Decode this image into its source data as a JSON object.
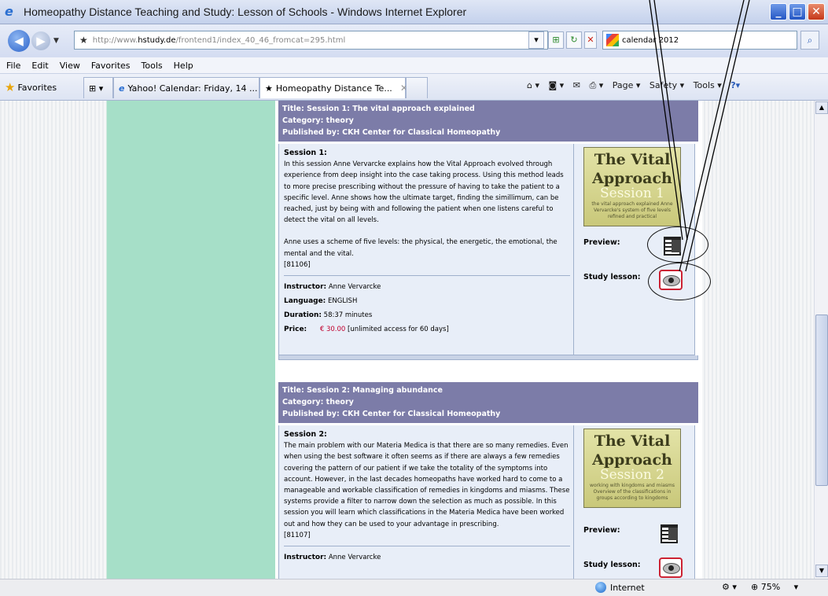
{
  "window": {
    "title": "Homeopathy Distance Teaching and Study: Lesson of Schools - Windows Internet Explorer",
    "minimize": "_",
    "maximize": "□",
    "close": "✕"
  },
  "address": {
    "url_prefix": "http://www.",
    "url_host": "hstudy.de",
    "url_path": "/frontend1/index_40_46_fromcat=295.html",
    "search_value": "calendar 2012"
  },
  "menu": [
    "File",
    "Edit",
    "View",
    "Favorites",
    "Tools",
    "Help"
  ],
  "favorites_label": "Favorites",
  "tabs": [
    {
      "label": "Yahoo! Calendar: Friday, 14 ..."
    },
    {
      "label": "Homeopathy Distance Te...",
      "close": "✕"
    }
  ],
  "command_bar": {
    "page": "Page ▾",
    "safety": "Safety ▾",
    "tools": "Tools ▾"
  },
  "lessons": [
    {
      "title": "Title: Session 1: The vital approach explained",
      "category": "Category: theory",
      "publisher": "Published by: CKH Center for Classical Homeopathy",
      "session": "Session 1:",
      "description": "In this session Anne Vervarcke explains how the Vital Approach evolved through experience from deep insight into the case taking process. Using this method leads to more precise prescribing without the pressure of having to take the patient to a specific level. Anne shows how the ultimate target, finding the simillimum, can be reached, just by being with and following the patient when one listens careful to detect the vital on all levels.",
      "description2": "Anne uses a scheme of five levels: the physical, the energetic, the emotional, the mental and the vital.",
      "code": "[81106]",
      "instructor_label": "Instructor:",
      "instructor": "Anne Vervarcke",
      "language_label": "Language:",
      "language": "ENGLISH",
      "duration_label": "Duration:",
      "duration": "58:37 minutes",
      "price_label": "Price:",
      "price": "€ 30.00",
      "price_note": "[unlimited access for 60 days]",
      "cover_title1": "The Vital",
      "cover_title2": "Approach",
      "cover_session": "Session 1",
      "cover_sub": "the vital approach explained Anne Vervarcke's system of five levels refined and practical",
      "preview_label": "Preview:",
      "study_label": "Study lesson:"
    },
    {
      "title": "Title: Session 2: Managing abundance",
      "category": "Category: theory",
      "publisher": "Published by: CKH Center for Classical Homeopathy",
      "session": "Session 2:",
      "description": "The main problem with our Materia Medica is that there are so many remedies. Even when using the best software it often seems as if there are always a few remedies covering the pattern of our patient if we take the totality of the symptoms into account. However, in the last decades homeopaths have worked hard to come to a manageable and workable classification of remedies in kingdoms and miasms. These systems provide a filter to narrow down the selection as much as possible. In this session you will learn which classifications in the Materia Medica have been worked out and how they can be used to your advantage in prescribing.",
      "code": "[81107]",
      "instructor_label": "Instructor:",
      "instructor": "Anne Vervarcke",
      "cover_title1": "The Vital",
      "cover_title2": "Approach",
      "cover_session": "Session 2",
      "cover_sub": "working with kingdoms and miasms Overview of the classifications in groups according to kingdoms",
      "preview_label": "Preview:",
      "study_label": "Study lesson:"
    }
  ],
  "status": {
    "zone": "Internet",
    "zoom": "75%"
  }
}
